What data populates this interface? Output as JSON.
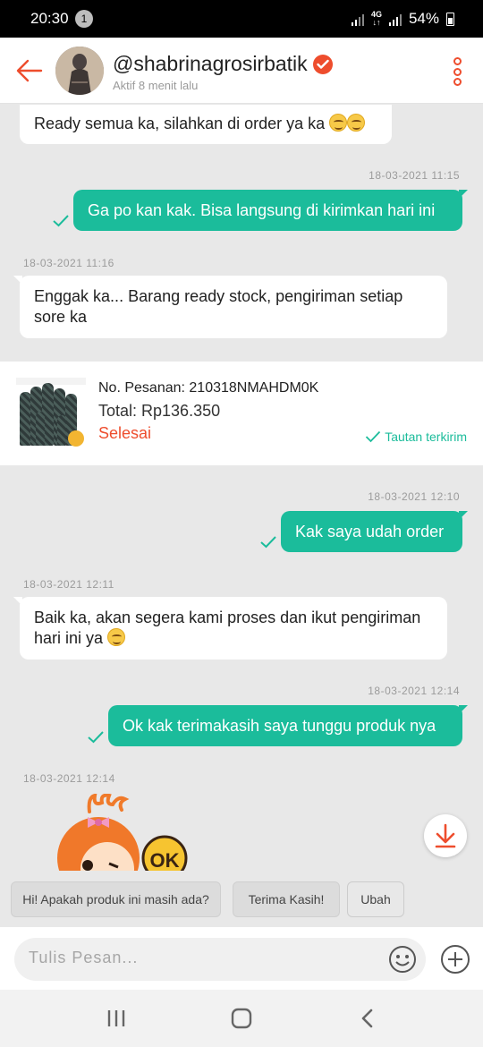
{
  "status_bar": {
    "time": "20:30",
    "notification_count": "1",
    "network": "4G",
    "battery": "54%"
  },
  "header": {
    "username": "@shabrinagrosirbatik",
    "status": "Aktif 8 menit lalu"
  },
  "messages": [
    {
      "side": "in",
      "text": "Ready semua ka, silahkan di order ya ka"
    },
    {
      "side": "out",
      "time": "18-03-2021 11:15",
      "text": "Ga po kan kak. Bisa langsung di kirimkan hari ini"
    },
    {
      "side": "in",
      "time": "18-03-2021 11:16",
      "text": "Enggak ka... Barang ready stock, pengiriman setiap sore ka"
    },
    {
      "side": "out",
      "time": "18-03-2021 12:10",
      "text": "Kak saya udah order"
    },
    {
      "side": "in",
      "time": "18-03-2021 12:11",
      "text": "Baik ka, akan segera kami proses dan ikut pengiriman hari ini ya"
    },
    {
      "side": "out",
      "time": "18-03-2021 12:14",
      "text": "Ok kak terimakasih saya tunggu produk nya"
    },
    {
      "side": "in",
      "time": "18-03-2021 12:14",
      "text": ""
    }
  ],
  "order": {
    "number": "No. Pesanan: 210318NMAHDM0K",
    "total": "Total: Rp136.350",
    "status": "Selesai",
    "link_status": "Tautan terkirim"
  },
  "sticker_text": "OK",
  "quick_replies": [
    "Hi! Apakah produk ini masih ada?",
    "Terima Kasih!",
    "Ubah"
  ],
  "input": {
    "placeholder": "Tulis Pesan..."
  },
  "colors": {
    "accent": "#ee4d2d",
    "outgoing": "#1bbc9b",
    "incoming": "#ffffff",
    "background": "#e8e8e8"
  }
}
